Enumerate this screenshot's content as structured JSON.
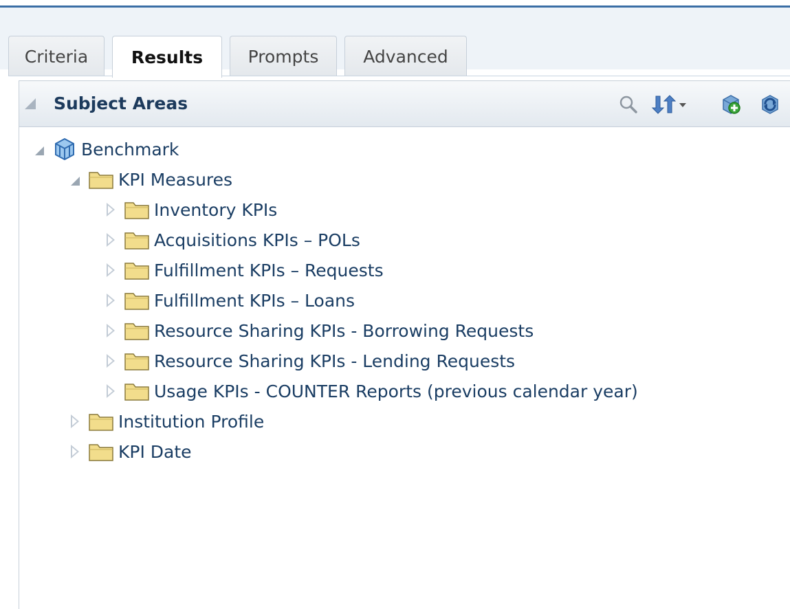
{
  "tabs": [
    {
      "label": "Criteria",
      "active": false
    },
    {
      "label": "Results",
      "active": true
    },
    {
      "label": "Prompts",
      "active": false
    },
    {
      "label": "Advanced",
      "active": false
    }
  ],
  "panel": {
    "title": "Subject Areas",
    "tools": [
      "search-icon",
      "sort-icon",
      "add-subject-area-icon",
      "refresh-icon"
    ]
  },
  "tree": {
    "root": {
      "label": "Benchmark",
      "expanded": true
    },
    "kpi_measures": {
      "label": "KPI Measures",
      "expanded": true
    },
    "kpi_children": [
      {
        "label": "Inventory KPIs"
      },
      {
        "label": "Acquisitions KPIs – POLs"
      },
      {
        "label": "Fulfillment KPIs – Requests"
      },
      {
        "label": "Fulfillment KPIs – Loans"
      },
      {
        "label": "Resource Sharing KPIs - Borrowing Requests"
      },
      {
        "label": "Resource Sharing KPIs - Lending Requests"
      },
      {
        "label": "Usage KPIs - COUNTER Reports (previous calendar year)"
      }
    ],
    "siblings": [
      {
        "label": "Institution Profile"
      },
      {
        "label": "KPI Date"
      }
    ]
  },
  "colors": {
    "accent": "#3a6ea5",
    "link_text": "#1a3d63",
    "folder_fill": "#f2dd8c",
    "folder_stroke": "#8a7a3c"
  }
}
